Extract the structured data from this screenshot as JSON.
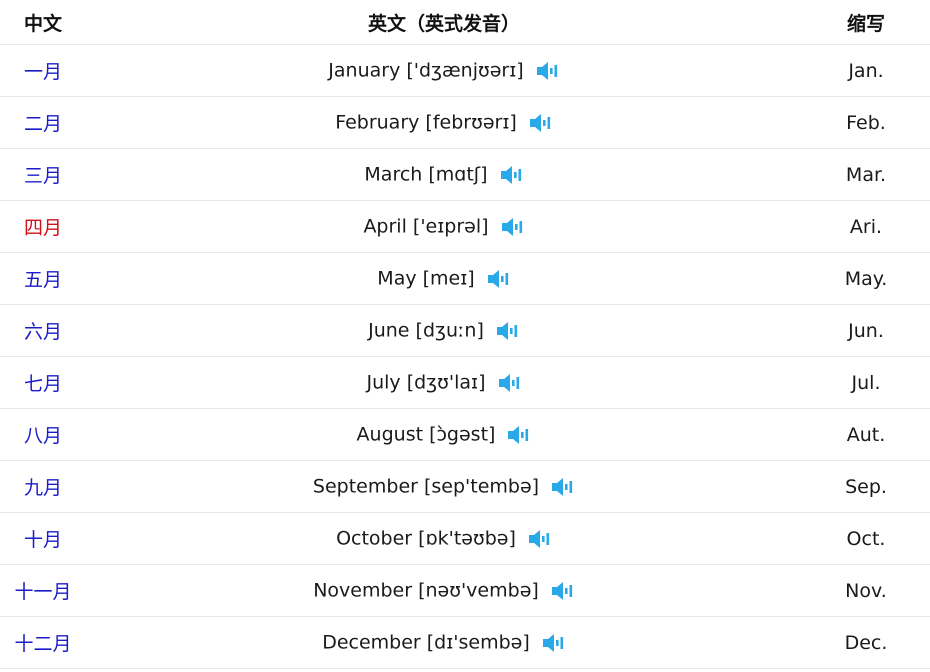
{
  "headers": {
    "chinese": "中文",
    "english": "英文（英式发音）",
    "abbreviation": "缩写"
  },
  "speaker_icon": "speaker-icon",
  "colors": {
    "chinese_text": "#1b1bc9",
    "highlight_text": "#d0111a",
    "speaker": "#29a9e8"
  },
  "months": [
    {
      "cn": "一月",
      "en": "January ['dʒænjʊərɪ]",
      "abbr": "Jan.",
      "highlight": false
    },
    {
      "cn": "二月",
      "en": "February [febrʊərɪ]",
      "abbr": "Feb.",
      "highlight": false
    },
    {
      "cn": "三月",
      "en": "March [mɑtʃ]",
      "abbr": "Mar.",
      "highlight": false
    },
    {
      "cn": "四月",
      "en": "April ['eɪprəl]",
      "abbr": "Ari.",
      "highlight": true
    },
    {
      "cn": "五月",
      "en": "May [meɪ]",
      "abbr": "May.",
      "highlight": false
    },
    {
      "cn": "六月",
      "en": "June [dʒuːn]",
      "abbr": "Jun.",
      "highlight": false
    },
    {
      "cn": "七月",
      "en": "July [dʒʊ'laɪ]",
      "abbr": "Jul.",
      "highlight": false
    },
    {
      "cn": "八月",
      "en": "August [ɔ̀gəst]",
      "abbr": "Aut.",
      "highlight": false
    },
    {
      "cn": "九月",
      "en": "September [sep'tembə]",
      "abbr": "Sep.",
      "highlight": false
    },
    {
      "cn": "十月",
      "en": "October [ɒk'təʊbə]",
      "abbr": "Oct.",
      "highlight": false
    },
    {
      "cn": "十一月",
      "en": "November [nəʊ'vembə]",
      "abbr": "Nov.",
      "highlight": false
    },
    {
      "cn": "十二月",
      "en": "December [dɪ'sembə]",
      "abbr": "Dec.",
      "highlight": false
    }
  ]
}
